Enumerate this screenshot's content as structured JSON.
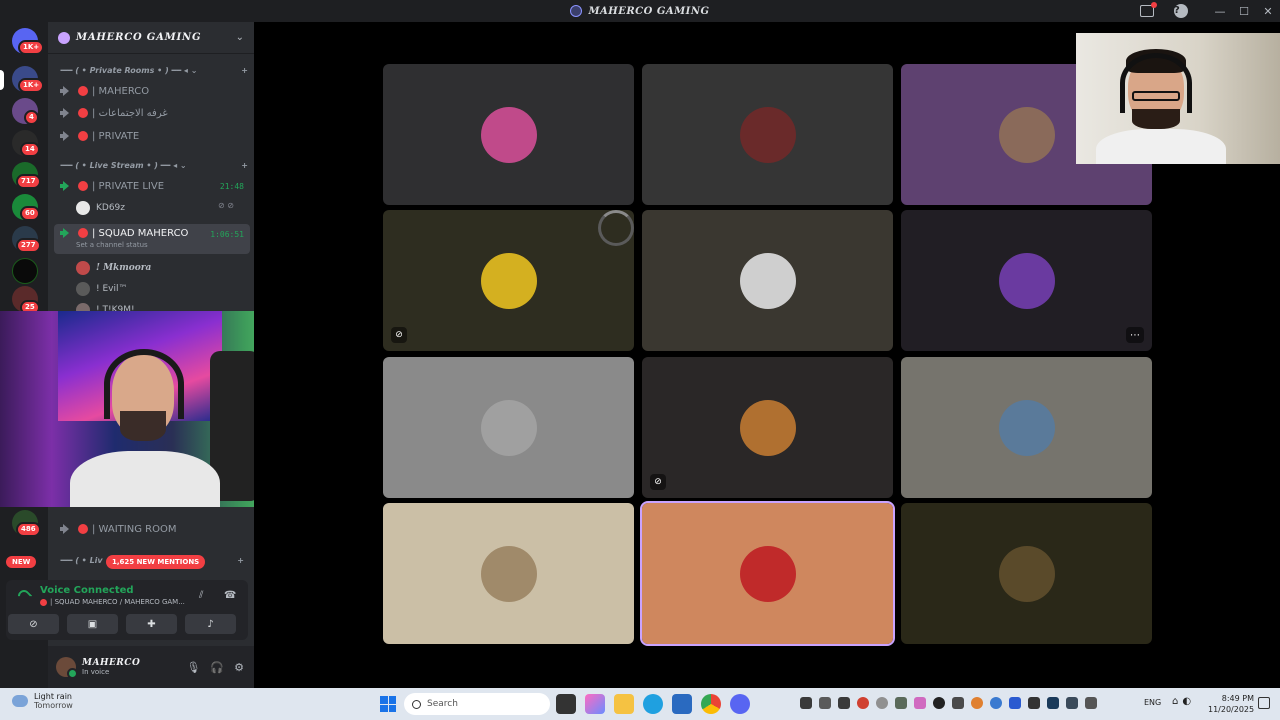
{
  "window": {
    "title": "MAHERCO GAMING"
  },
  "servers": [
    {
      "badge": "1K+",
      "color": "#5865f2"
    },
    {
      "badge": "1K+",
      "color": "#3a4a8a"
    },
    {
      "badge": "4",
      "color": "#6a4a8a"
    },
    {
      "badge": "14",
      "color": "#2a2a2a"
    },
    {
      "badge": "717",
      "color": "#1a6a2a"
    },
    {
      "badge": "60",
      "color": "#1a8a3a"
    },
    {
      "badge": "277",
      "color": "#2a3a4a"
    },
    {
      "badge": "",
      "color": "#0a0a0a"
    },
    {
      "badge": "25",
      "color": "#5a2a2a"
    },
    {
      "badge": "486",
      "color": "#2a4a2a"
    }
  ],
  "guild": {
    "name": "MAHERCO GAMING"
  },
  "categories": {
    "private_rooms": "╺━━ ( • Private Rooms • ) ━━ ◂ ⌄",
    "live_stream": "╺━━ ( • Live Stream • ) ━━ ◂ ⌄",
    "live_cut": "╺━━ ( • Liv"
  },
  "channels": {
    "maherco": "| MAHERCO",
    "meetings": "| غرفه الاجتماعات",
    "private": "| PRIVATE",
    "private_live": "| PRIVATE LIVE",
    "private_live_timer": "21:48",
    "squad": "| SQUAD MAHERCO",
    "squad_timer": "1:06:51",
    "squad_status": "Set a channel status",
    "waiting": "| WAITING ROOM"
  },
  "members": {
    "kd": "KD69z",
    "mkmoora": "! Mkmoora",
    "evil": "! Evil™",
    "cut": "! T!K9M!"
  },
  "badges": {
    "new": "NEW",
    "mentions": "1,625 NEW MENTIONS"
  },
  "voice": {
    "status": "Voice Connected",
    "channel": "| SQUAD MAHERCO / MAHERCO GAM..."
  },
  "user": {
    "name": "MAHERCO",
    "status": "In voice"
  },
  "tiles": [
    {
      "bg": "#2f2f31",
      "avatar": "#c04a8a",
      "muted": false,
      "more": false
    },
    {
      "bg": "#353535",
      "avatar": "#6a2a2a",
      "muted": false,
      "more": false
    },
    {
      "bg": "#5e4170",
      "avatar": "#8a6a5a",
      "muted": false,
      "more": false
    },
    {
      "bg": "#2e2d20",
      "avatar": "#d4b020",
      "muted": true,
      "more": false
    },
    {
      "bg": "#3a3730",
      "avatar": "#cfcfcf",
      "muted": false,
      "more": false
    },
    {
      "bg": "#211e24",
      "avatar": "#6a3aa0",
      "muted": false,
      "more": true
    },
    {
      "bg": "#8a8a8a",
      "avatar": "#a0a0a0",
      "muted": false,
      "more": false
    },
    {
      "bg": "#2a2727",
      "avatar": "#b07030",
      "muted": true,
      "more": false
    },
    {
      "bg": "#76746d",
      "avatar": "#5a7a9a",
      "muted": false,
      "more": false
    },
    {
      "bg": "#cbbfa6",
      "avatar": "#a08a6a",
      "muted": false,
      "more": false
    },
    {
      "bg": "#cf875e",
      "avatar": "#c02a2a",
      "muted": false,
      "more": false
    },
    {
      "bg": "#2a2818",
      "avatar": "#5a4a2a",
      "muted": false,
      "more": false
    }
  ],
  "taskbar": {
    "weather_main": "Light rain",
    "weather_sub": "Tomorrow",
    "search_placeholder": "Search",
    "lang": "ENG",
    "time": "8:49 PM",
    "date": "11/20/2025"
  }
}
